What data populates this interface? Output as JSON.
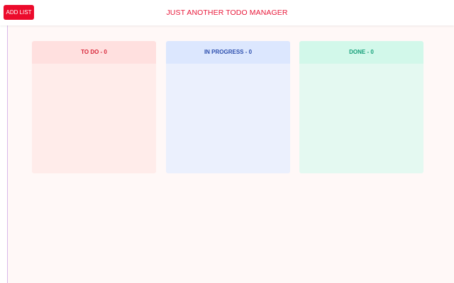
{
  "header": {
    "add_list_label": "ADD LIST",
    "title": "JUST ANOTHER TODO MANAGER"
  },
  "columns": [
    {
      "label": "TO DO - 0",
      "accent": "#d8273a"
    },
    {
      "label": "IN PROGRESS - 0",
      "accent": "#2d4fae"
    },
    {
      "label": "DONE - 0",
      "accent": "#17a07a"
    }
  ],
  "colors": {
    "brand": "#ec0b2c",
    "board_background": "#fff8f7"
  }
}
